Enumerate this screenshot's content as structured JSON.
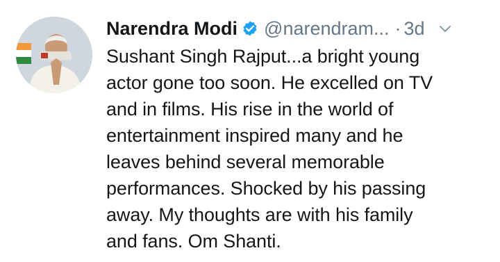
{
  "tweet": {
    "author": {
      "name": "Narendra Modi",
      "handle": "@narendram...",
      "verified_icon": "verified-badge-icon",
      "avatar_icon": "profile-avatar"
    },
    "separator": "·",
    "time": "3d",
    "more_icon": "chevron-down-icon",
    "text": "Sushant Singh Rajput...a bright young\nactor gone too soon. He excelled on TV\nand in films. His rise in the world of\nentertainment inspired many and he\nleaves behind several memorable\nperformances. Shocked by his passing\naway. My thoughts are with his family\nand fans. Om Shanti."
  },
  "colors": {
    "text_primary": "#14171a",
    "text_secondary": "#657786",
    "verified_blue": "#1da1f2",
    "background": "#ffffff"
  }
}
